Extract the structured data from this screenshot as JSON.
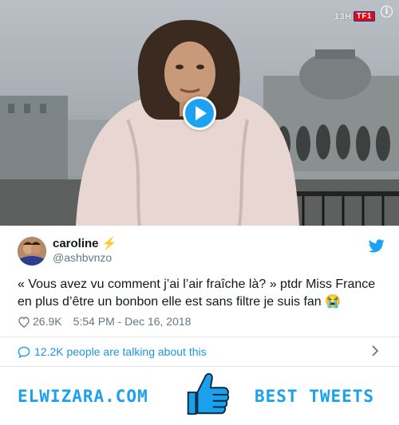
{
  "video": {
    "channel_time": "13H",
    "channel_logo": "TF1",
    "play_icon": "play-icon",
    "info_icon": "info-icon",
    "info_label": "i"
  },
  "tweet": {
    "author_name": "caroline",
    "author_emoji": "⚡",
    "handle": "@ashbvnzo",
    "text": "« Vous avez vu comment j’ai l’air fraîche là? » ptdr Miss France en plus d’être un bonbon elle est sans filtre je suis fan 😭",
    "likes": "26.9K",
    "timestamp": "5:54 PM - Dec 16, 2018",
    "talking": "12.2K people are talking about this"
  },
  "banner": {
    "left_text": "ELWIZARA.COM",
    "right_text": "BEST TWEETS"
  },
  "colors": {
    "twitter_blue": "#1da1f2",
    "link_blue": "#1b95e0",
    "banner_blue": "#1aa0ec",
    "secondary_text": "#657786",
    "divider": "#e1e8ed"
  }
}
